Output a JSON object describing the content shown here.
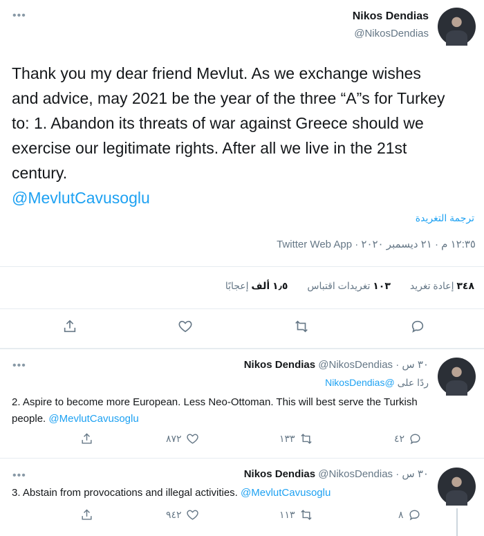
{
  "main_tweet": {
    "display_name": "Nikos Dendias",
    "handle": "@NikosDendias",
    "text": "Thank you my dear friend Mevlut. As we exchange wishes and advice, may 2021 be the year of the three “A”s for Turkey to: 1. Abandon its threats of war against Greece should we exercise our legitimate rights. After all we live in the 21st century.",
    "mention": "@MevlutCavusoglu",
    "translate_label": "ترجمة التغريدة",
    "meta": "١٢:٣٥ م · ٢١ ديسمبر ٢٠٢٠ · Twitter Web App",
    "stats": {
      "retweets_count": "٣٤٨",
      "retweets_label": "إعادة تغريد",
      "quotes_count": "١٠٣",
      "quotes_label": "تغريدات اقتباس",
      "likes_count": "١٫٥ ألف",
      "likes_label": "إعجابًا"
    },
    "actions": [
      "reply-icon",
      "retweet-icon",
      "like-icon",
      "share-icon"
    ]
  },
  "replies": [
    {
      "display_name": "Nikos Dendias",
      "handle": "@NikosDendias",
      "time": "· ٣٠ س",
      "replying_to_label": "ردًا على",
      "replying_to_handle": "@NikosDendias",
      "text": "2. Aspire to become more European. Less Neo-Ottoman. This will best serve the Turkish people.",
      "mention": "@MevlutCavusoglu",
      "reply_count": "٤٢",
      "retweet_count": "١٣٣",
      "like_count": "٨٧٢"
    },
    {
      "display_name": "Nikos Dendias",
      "handle": "@NikosDendias",
      "time": "· ٣٠ س",
      "text": "3. Abstain from provocations and illegal activities.",
      "mention": "@MevlutCavusoglu",
      "reply_count": "٨",
      "retweet_count": "١١٣",
      "like_count": "٩٤٢"
    }
  ],
  "colors": {
    "accent": "#1da1f2",
    "text": "#14171a",
    "muted": "#657786",
    "divider": "#e6ecf0"
  }
}
